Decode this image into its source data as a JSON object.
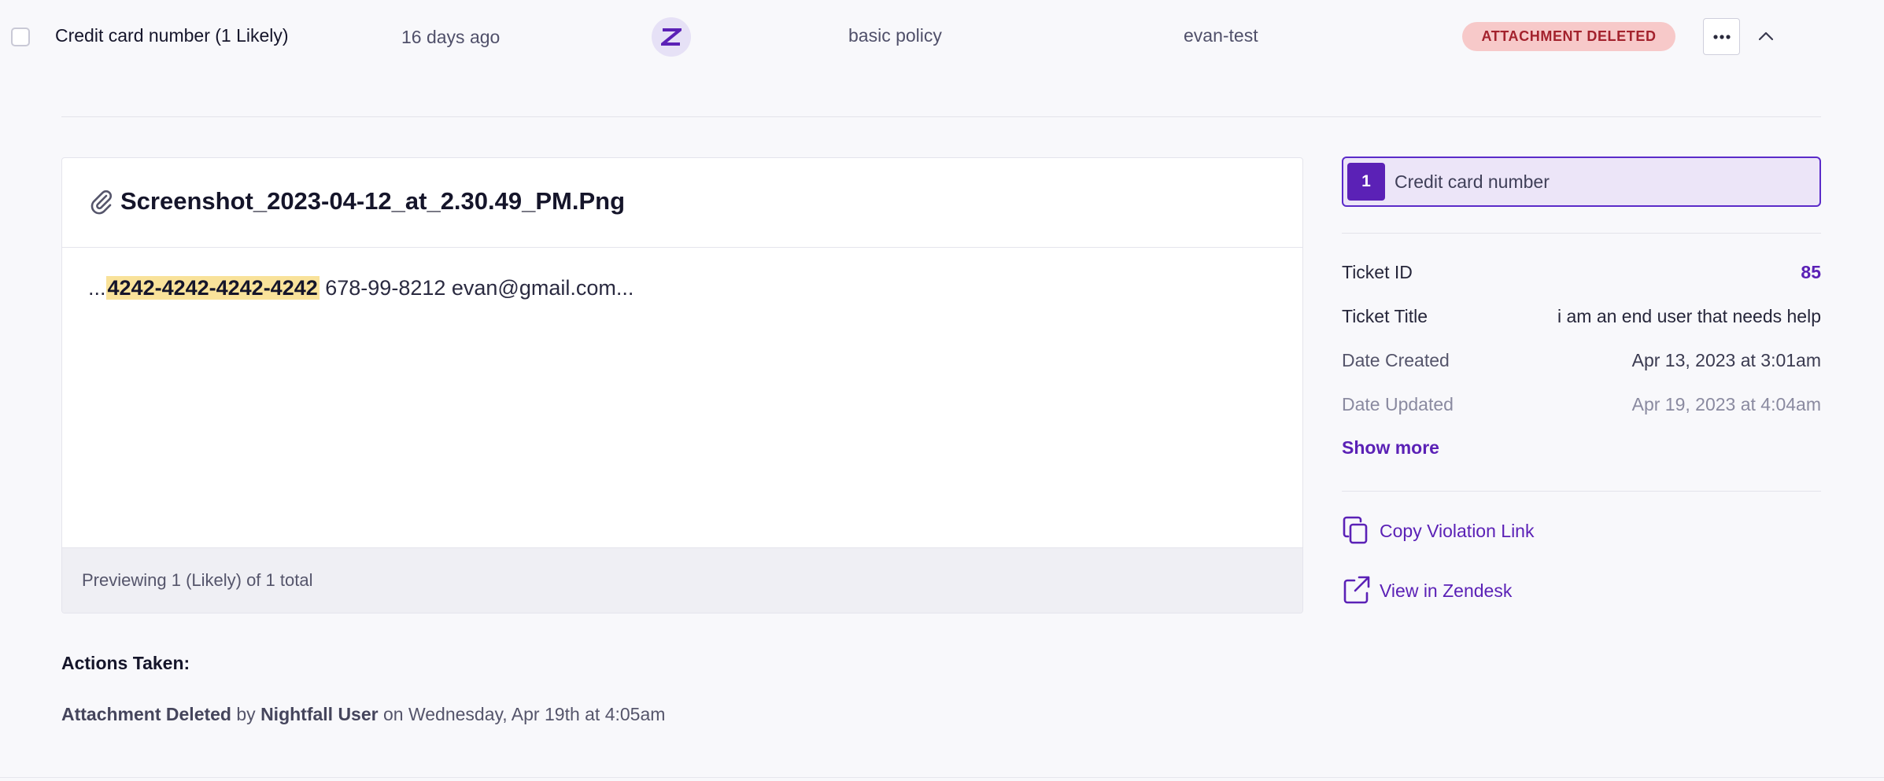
{
  "row": {
    "detector_name": "Credit card number (1 Likely)",
    "time_ago": "16 days ago",
    "app_icon": "zendesk-icon",
    "policy": "basic policy",
    "user": "evan-test",
    "status": "ATTACHMENT DELETED",
    "more_icon": "ellipsis-icon",
    "collapse_icon": "chevron-up-icon"
  },
  "preview": {
    "file_name": "Screenshot_2023-04-12_at_2.30.49_PM.Png",
    "snippet_prefix": "...",
    "snippet_match": "4242-4242-4242-4242",
    "snippet_suffix": " 678-99-8212 evan@gmail.com...",
    "footer": "Previewing 1 (Likely) of 1 total"
  },
  "actions": {
    "label": "Actions Taken:",
    "action": "Attachment Deleted",
    "by": " by ",
    "actor": "Nightfall User",
    "when": " on Wednesday, Apr 19th at 4:05am"
  },
  "details": {
    "detector_count": "1",
    "detector_label": "Credit card number",
    "fields": [
      {
        "label": "Ticket ID",
        "value": "85"
      },
      {
        "label": "Ticket Title",
        "value": "i am an end user that needs help"
      },
      {
        "label": "Date Created",
        "value": "Apr 13, 2023 at 3:01am"
      },
      {
        "label": "Date Updated",
        "value": "Apr 19, 2023 at 4:04am"
      }
    ],
    "show_more": "Show more",
    "links": [
      {
        "label": "Copy Violation Link",
        "icon": "copy-icon"
      },
      {
        "label": "View in Zendesk",
        "icon": "external-link-icon"
      }
    ]
  },
  "colors": {
    "accent": "#5b21b6",
    "badge_bg": "#f7c9c9",
    "badge_text": "#a3222d",
    "highlight": "#f9e29a"
  }
}
